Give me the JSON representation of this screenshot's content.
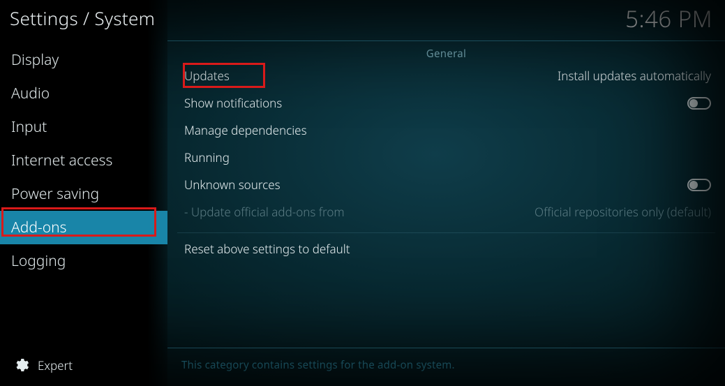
{
  "header": {
    "breadcrumb": "Settings / System",
    "clock": "5:46 PM"
  },
  "sidebar": {
    "items": [
      {
        "label": "Display"
      },
      {
        "label": "Audio"
      },
      {
        "label": "Input"
      },
      {
        "label": "Internet access"
      },
      {
        "label": "Power saving"
      },
      {
        "label": "Add-ons",
        "active": true
      },
      {
        "label": "Logging"
      }
    ],
    "level": "Expert"
  },
  "main": {
    "section": "General",
    "rows": [
      {
        "label": "Updates",
        "value": "Install updates automatically",
        "type": "select",
        "highlighted": true
      },
      {
        "label": "Show notifications",
        "type": "toggle",
        "on": false
      },
      {
        "label": "Manage dependencies",
        "type": "link"
      },
      {
        "label": "Running",
        "type": "link"
      },
      {
        "label": "Unknown sources",
        "type": "toggle",
        "on": false
      },
      {
        "label": "- Update official add-ons from",
        "value": "Official repositories only (default)",
        "type": "select",
        "disabled": true
      },
      {
        "label": "Reset above settings to default",
        "type": "action",
        "gap": true
      }
    ],
    "help": "This category contains settings for the add-on system."
  }
}
